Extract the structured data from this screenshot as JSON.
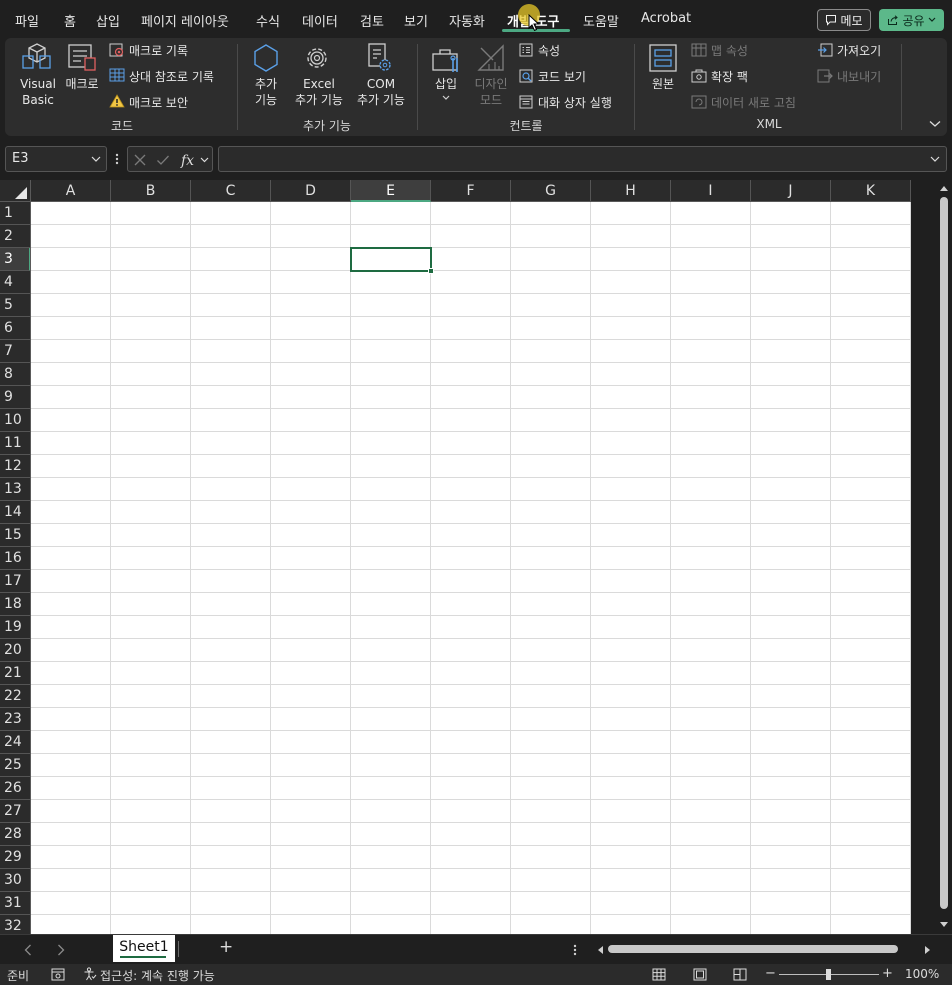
{
  "menu": {
    "items": [
      "파일",
      "홈",
      "삽입",
      "페이지 레이아웃",
      "수식",
      "데이터",
      "검토",
      "보기",
      "자동화",
      "개발 도구",
      "도움말",
      "Acrobat"
    ],
    "memo_label": "메모",
    "share_label": "공유"
  },
  "ribbon": {
    "code": {
      "group_label": "코드",
      "visual_basic_1": "Visual",
      "visual_basic_2": "Basic",
      "macro": "매크로",
      "record_macro": "매크로 기록",
      "relative_ref": "상대 참조로 기록",
      "macro_security": "매크로 보안"
    },
    "addins": {
      "group_label": "추가 기능",
      "addins_1": "추가",
      "addins_2": "기능",
      "excel_addins_1": "Excel",
      "excel_addins_2": "추가 기능",
      "com_addins_1": "COM",
      "com_addins_2": "추가 기능"
    },
    "controls": {
      "group_label": "컨트롤",
      "insert": "삽입",
      "design_mode_1": "디자인",
      "design_mode_2": "모드",
      "properties": "속성",
      "view_code": "코드 보기",
      "run_dialog": "대화 상자 실행"
    },
    "xml": {
      "group_label": "XML",
      "source": "원본",
      "map_properties": "맵 속성",
      "expansion_packs": "확장 팩",
      "refresh_data": "데이터 새로 고침",
      "import": "가져오기",
      "export": "내보내기"
    }
  },
  "formula_bar": {
    "name_box": "E3",
    "formula": ""
  },
  "grid": {
    "columns": [
      "A",
      "B",
      "C",
      "D",
      "E",
      "F",
      "G",
      "H",
      "I",
      "J",
      "K"
    ],
    "rows": [
      "1",
      "2",
      "3",
      "4",
      "5",
      "6",
      "7",
      "8",
      "9",
      "10",
      "11",
      "12",
      "13",
      "14",
      "15",
      "16",
      "17",
      "18",
      "19",
      "20",
      "21",
      "22",
      "23",
      "24",
      "25",
      "26",
      "27",
      "28",
      "29",
      "30",
      "31",
      "32"
    ],
    "selected_column": "E",
    "selected_row": "3"
  },
  "sheets": {
    "tabs": [
      "Sheet1"
    ],
    "add_label": "+"
  },
  "status": {
    "ready": "준비",
    "accessibility": "접근성: 계속 진행 가능",
    "zoom_minus": "−",
    "zoom_plus": "+",
    "zoom": "100%"
  },
  "colors": {
    "accent": "#1e6b41",
    "tab_accent": "#4ca882",
    "share": "#5cb88a"
  }
}
